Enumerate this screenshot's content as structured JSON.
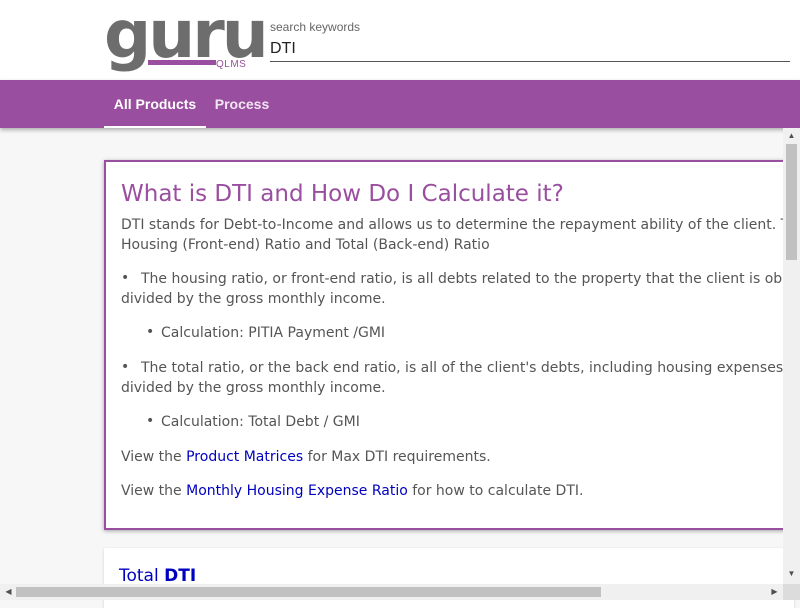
{
  "logo": {
    "main": "guru",
    "sub": "QLMS"
  },
  "search": {
    "label": "search keywords",
    "value": "DTI"
  },
  "nav": {
    "tabs": [
      {
        "label": "All Products",
        "active": true
      },
      {
        "label": "Process",
        "active": false
      }
    ]
  },
  "article": {
    "title": "What is DTI and How Do I Calculate it?",
    "intro_line1": "DTI stands for Debt-to-Income and allows us to determine the repayment ability of the client. There",
    "intro_line2": "Housing (Front-end) Ratio and Total (Back-end) Ratio",
    "bullet_glyph": "•",
    "bullet1_line1": "The housing ratio, or front-end ratio, is all debts related to the property that the client is obligate",
    "bullet1_line2": "divided by the gross monthly income.",
    "sub1": "Calculation: PITIA Payment /GMI",
    "bullet2_line1": "The total ratio, or the back end ratio, is all of the client's debts, including housing expenses and o",
    "bullet2_line2": "divided by the gross monthly income.",
    "sub2": "Calculation: Total Debt / GMI",
    "view1_prefix": "View the ",
    "view1_link": "Product Matrices",
    "view1_suffix": " for Max DTI requirements.",
    "view2_prefix": "View the ",
    "view2_link": "Monthly Housing Expense Ratio",
    "view2_suffix": " for how to calculate DTI."
  },
  "result2": {
    "title_prefix": "Total ",
    "title_highlight": "DTI"
  },
  "colors": {
    "brand": "#9a4e9f",
    "link": "#0000c0",
    "logo_gray": "#6d6d6d"
  },
  "icons": {
    "scroll_up": "▲",
    "scroll_down": "▼",
    "scroll_left": "◀",
    "scroll_right": "▶"
  }
}
